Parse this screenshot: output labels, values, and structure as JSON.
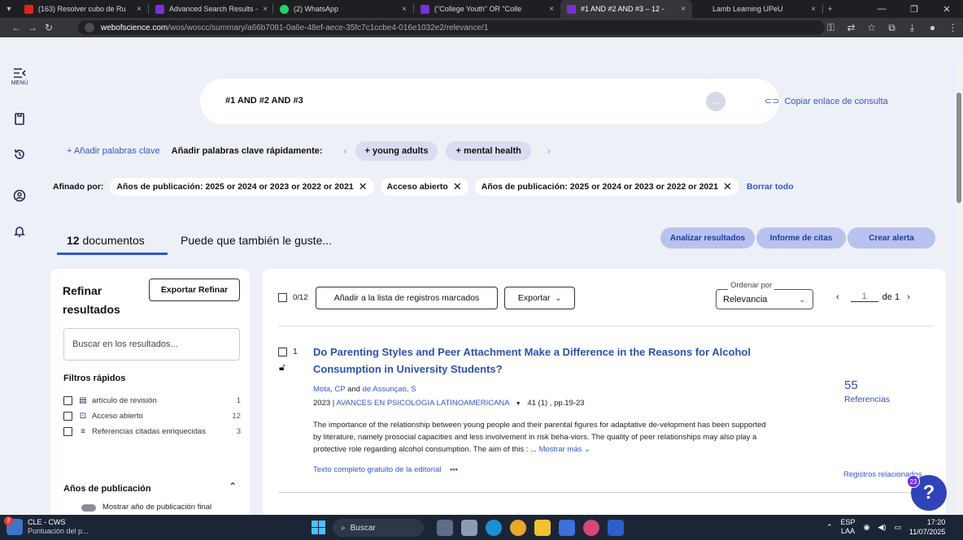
{
  "browser": {
    "tabs": [
      {
        "title": "(163) Resolver cubo de Ru",
        "color": "#e62117"
      },
      {
        "title": "Advanced Search Results -",
        "color": "#7b2fd6"
      },
      {
        "title": "(2) WhatsApp",
        "color": "#25d366"
      },
      {
        "title": "(\"College Youth\" OR \"Colle",
        "color": "#7b2fd6"
      },
      {
        "title": "#1 AND #2 AND #3 – 12 -",
        "color": "#7b2fd6"
      },
      {
        "title": "Lamb Learning UPeU",
        "color": "#35363a"
      }
    ],
    "url_host": "webofscience.com",
    "url_path": "/wos/woscc/summary/a66b7081-0a6e-48ef-aece-35fc7c1ccbe4-016e1032e2/relevance/1"
  },
  "rail": {
    "menu_label": "MENÚ"
  },
  "query": {
    "text": "#1 AND #2 AND #3",
    "copy_link": "Copiar enlace de consulta"
  },
  "keywords": {
    "add_label": "+ Añadir palabras clave",
    "quick_label": "Añadir palabras clave rápidamente:",
    "chips": [
      "+ young adults",
      "+ mental health"
    ]
  },
  "refined": {
    "label": "Afinado por:",
    "filters": [
      "Años de publicación: 2025 or 2024 or 2023 or 2022 or 2021",
      "Acceso abierto",
      "Años de publicación: 2025 or 2024 or 2023 or 2022 or 2021"
    ],
    "clear": "Borrar todo"
  },
  "tabs": {
    "count": "12",
    "count_suffix": " documentos",
    "may_like": "Puede que también le guste..."
  },
  "actions": {
    "analyze": "Analizar resultados",
    "citation_report": "Informe de citas",
    "create_alert": "Crear alerta"
  },
  "sidebar": {
    "title": "Refinar resultados",
    "export": "Exportar Refinar",
    "search_placeholder": "Buscar en los resultados...",
    "quick_filters_title": "Filtros rápidos",
    "quick_filters": [
      {
        "label": "artículo de revisión",
        "count": "1",
        "icon": "document-icon"
      },
      {
        "label": "Acceso abierto",
        "count": "12",
        "icon": "lock-open-icon"
      },
      {
        "label": "Referencias citadas enriquecidas",
        "count": "3",
        "icon": "list-star-icon"
      }
    ],
    "pub_years_title": "Años de publicación",
    "toggle_label": "Mostrar año de publicación final"
  },
  "results": {
    "select_count": "0/12",
    "add_to_marked": "Añadir a la lista de registros marcados",
    "export": "Exportar",
    "sort_label": "Ordenar por",
    "sort_value": "Relevancia",
    "page_current": "1",
    "page_of": "de 1",
    "records": [
      {
        "index": "1",
        "title": "Do Parenting Styles and Peer Attachment Make a Difference in the Reasons for Alcohol Consumption in University Students?",
        "author1": "Mota, CP",
        "and": " and ",
        "author2": "de Assunçao, S",
        "year": "2023 | ",
        "journal": "AVANCES EN PSICOLOGIA LATINOAMERICANA",
        "volume": "41 (1) , pp.19-23",
        "abstract": "The importance of the relationship between young people and their parental figures for adaptative de-velopment has been supported by literature, namely prosocial capacities and less involvement in risk beha-viors. The quality of peer relationships may also play a protective role regarding alcohol consumption. The aim of this : ...",
        "more": "Mostrar más ⌄",
        "full_text": "Texto completo gratuito de la editorial",
        "citations": "55",
        "citations_label": "Referencias",
        "related": "Registros relacionados"
      }
    ]
  },
  "help": {
    "badge": "23",
    "label": "?"
  },
  "taskbar": {
    "weather_badge": "2",
    "weather_title": "CLE - CWS",
    "weather_sub": "Puntuación del p...",
    "search": "Buscar",
    "lang_top": "ESP",
    "lang_bottom": "LAA",
    "time": "17:20",
    "date": "11/07/2025"
  }
}
